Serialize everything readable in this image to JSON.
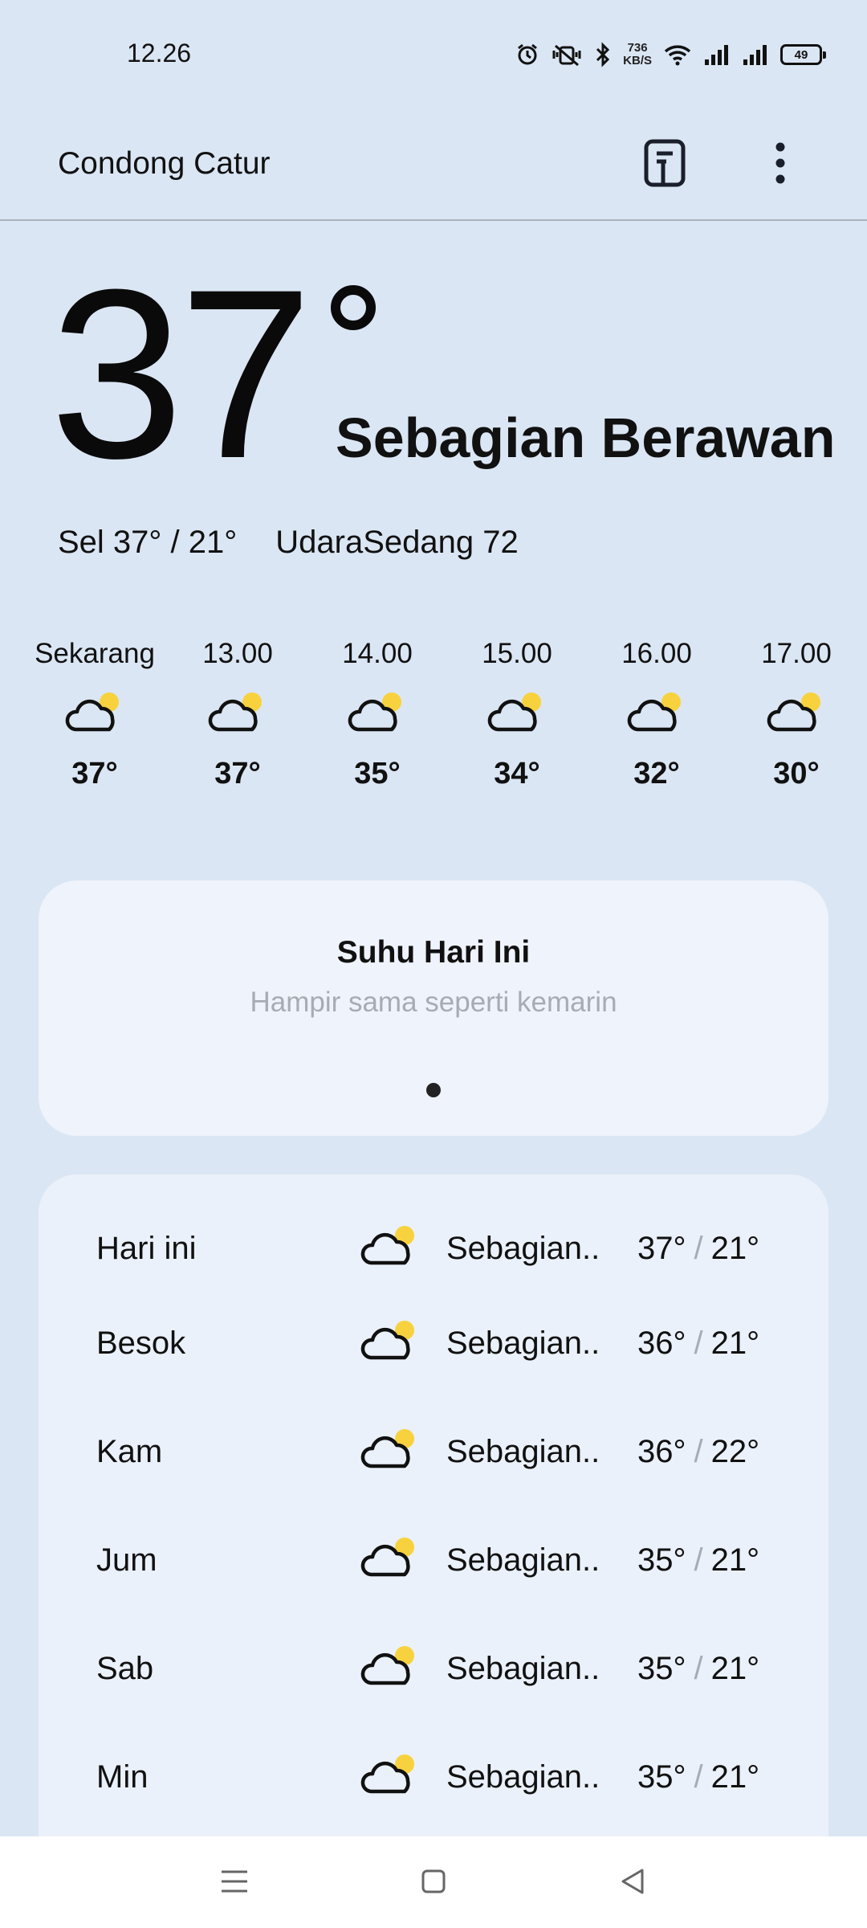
{
  "status_bar": {
    "time": "12.26",
    "net_speed_value": "736",
    "net_speed_unit": "KB/S",
    "battery": "49",
    "icons": [
      "alarm-icon",
      "vibrate-off-icon",
      "bluetooth-icon",
      "wifi-icon",
      "signal-icon",
      "signal-icon",
      "battery-icon"
    ]
  },
  "header": {
    "location": "Condong Catur",
    "icons": [
      "document-icon",
      "more-vert-icon"
    ]
  },
  "current": {
    "temperature": "37",
    "condition": "Sebagian Berawan",
    "high_low": "Sel 37° / 21°",
    "air_quality": "UdaraSedang 72"
  },
  "hourly": [
    {
      "time": "Sekarang",
      "temp": "37°",
      "icon": "partly-cloudy-icon"
    },
    {
      "time": "13.00",
      "temp": "37°",
      "icon": "partly-cloudy-icon"
    },
    {
      "time": "14.00",
      "temp": "35°",
      "icon": "partly-cloudy-icon"
    },
    {
      "time": "15.00",
      "temp": "34°",
      "icon": "partly-cloudy-icon"
    },
    {
      "time": "16.00",
      "temp": "32°",
      "icon": "partly-cloudy-icon"
    },
    {
      "time": "17.00",
      "temp": "30°",
      "icon": "partly-cloudy-icon"
    }
  ],
  "today_card": {
    "title": "Suhu Hari Ini",
    "subtitle": "Hampir sama seperti kemarin"
  },
  "forecast": [
    {
      "day": "Hari ini",
      "condition": "Sebagian..",
      "high": "37°",
      "low": "21°"
    },
    {
      "day": "Besok",
      "condition": "Sebagian..",
      "high": "36°",
      "low": "21°"
    },
    {
      "day": "Kam",
      "condition": "Sebagian..",
      "high": "36°",
      "low": "22°"
    },
    {
      "day": "Jum",
      "condition": "Sebagian..",
      "high": "35°",
      "low": "21°"
    },
    {
      "day": "Sab",
      "condition": "Sebagian..",
      "high": "35°",
      "low": "21°"
    },
    {
      "day": "Min",
      "condition": "Sebagian..",
      "high": "35°",
      "low": "21°"
    }
  ],
  "colors": {
    "background": "#dbe6f4",
    "card": "#eff3fb",
    "sun": "#f7d23e",
    "muted_text": "#a6acb4"
  },
  "nav_icons": [
    "menu-icon",
    "home-icon",
    "back-icon"
  ]
}
